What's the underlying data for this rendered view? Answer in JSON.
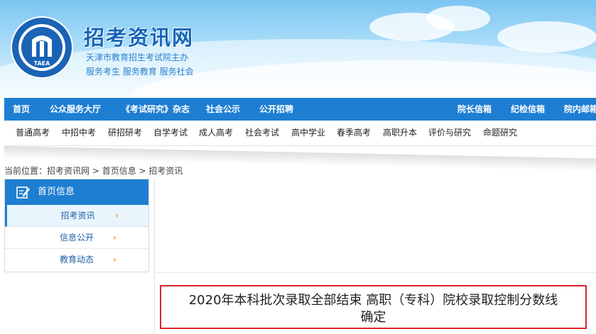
{
  "header": {
    "site_name": "招考资讯网",
    "subtitle": "天津市教育招生考试院主办",
    "slogan": "服务考生 服务教育 服务社会",
    "logo_text": "TAEA"
  },
  "main_nav": {
    "items": [
      "首页",
      "公众服务大厅",
      "《考试研究》杂志",
      "社会公示",
      "公开招聘"
    ],
    "right_items": [
      "院长信箱",
      "纪检信箱",
      "院内邮箱"
    ]
  },
  "sub_nav": {
    "items": [
      "普通高考",
      "中招中考",
      "研招研考",
      "自学考试",
      "成人高考",
      "社会考试",
      "高中学业",
      "春季高考",
      "高职升本",
      "评价与研究",
      "命题研究"
    ]
  },
  "breadcrumb": {
    "prefix": "当前位置：",
    "items": [
      "招考资讯网",
      "首页信息",
      "招考资讯"
    ],
    "separator": " > "
  },
  "sidebar": {
    "title": "首页信息",
    "items": [
      {
        "label": "招考资讯",
        "active": true
      },
      {
        "label": "信息公开",
        "active": false
      },
      {
        "label": "教育动态",
        "active": false
      }
    ],
    "chevron": "›"
  },
  "article": {
    "title": "2020年本科批次录取全部结束 高职（专科）院校录取控制分数线确定"
  },
  "colors": {
    "nav_blue": "#1e7ed2",
    "highlight_red": "#d9252b",
    "chevron_orange": "#f0a11d"
  }
}
